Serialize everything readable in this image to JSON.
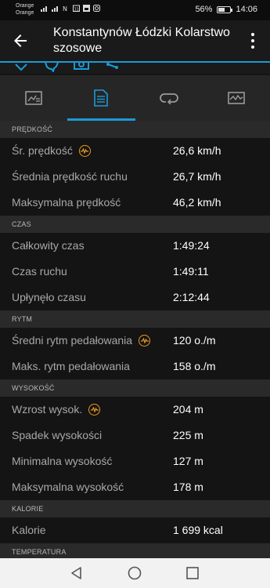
{
  "status_bar": {
    "carrier_1": "Orange",
    "carrier_2": "Orange",
    "battery_percent": "56%",
    "battery_level": 0.56,
    "time": "14:06"
  },
  "app_bar": {
    "title": "Konstantynów Łódzki Kolarstwo szosowe"
  },
  "tabs": [
    {
      "icon": "summary-chart-icon",
      "active": false
    },
    {
      "icon": "details-list-icon",
      "active": true
    },
    {
      "icon": "laps-icon",
      "active": false
    },
    {
      "icon": "graph-icon",
      "active": false
    }
  ],
  "sections": {
    "speed": {
      "header": "PRĘDKOŚĆ",
      "rows": [
        {
          "label": "Śr. prędkość",
          "value": "26,6 km/h"
        },
        {
          "label": "Średnia prędkość ruchu",
          "value": "26,7 km/h"
        },
        {
          "label": "Maksymalna prędkość",
          "value": "46,2 km/h"
        }
      ]
    },
    "time": {
      "header": "CZAS",
      "rows": [
        {
          "label": "Całkowity czas",
          "value": "1:49:24"
        },
        {
          "label": "Czas ruchu",
          "value": "1:49:11"
        },
        {
          "label": "Upłynęło czasu",
          "value": "2:12:44"
        }
      ]
    },
    "cadence": {
      "header": "RYTM",
      "rows": [
        {
          "label": "Średni rytm pedałowania",
          "value": "120 o./m"
        },
        {
          "label": "Maks. rytm pedałowania",
          "value": "158 o./m"
        }
      ]
    },
    "elevation": {
      "header": "WYSOKOŚĆ",
      "rows": [
        {
          "label": "Wzrost wysok.",
          "value": "204 m"
        },
        {
          "label": "Spadek wysokości",
          "value": "225 m"
        },
        {
          "label": "Minimalna wysokość",
          "value": "127 m"
        },
        {
          "label": "Maksymalna wysokość",
          "value": "178 m"
        }
      ]
    },
    "calories": {
      "header": "KALORIE",
      "rows": [
        {
          "label": "Kalorie",
          "value": "1 699 kcal"
        }
      ]
    },
    "temperature": {
      "header": "TEMPERATURA"
    }
  },
  "colors": {
    "accent": "#1b9ad6",
    "badge": "#e89a1e"
  }
}
